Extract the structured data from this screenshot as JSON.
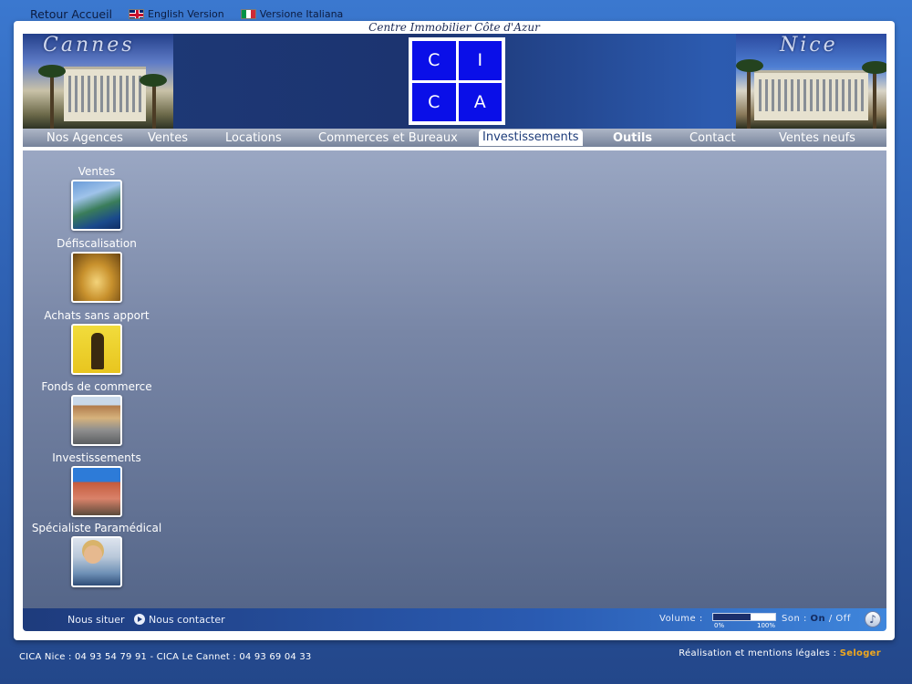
{
  "topbar": {
    "home": "Retour Accueil",
    "english": "English Version",
    "italian": "Versione Italiana"
  },
  "site_title": "Centre Immobilier Côte d'Azur",
  "banner": {
    "left_city": "Cannes",
    "right_city": "Nice",
    "logo_letters": [
      "C",
      "I",
      "C",
      "A"
    ]
  },
  "nav": {
    "items": [
      {
        "label": "Nos Agences"
      },
      {
        "label": "Ventes"
      },
      {
        "label": "Locations"
      },
      {
        "label": "Commerces et Bureaux"
      },
      {
        "label": "Investissements",
        "active": true
      },
      {
        "label": "Outils",
        "bold": true
      },
      {
        "label": "Contact"
      },
      {
        "label": "Ventes neufs"
      }
    ]
  },
  "categories": [
    {
      "label": "Ventes",
      "icon": "coast-photo-icon"
    },
    {
      "label": "Défiscalisation",
      "icon": "gold-coins-photo-icon"
    },
    {
      "label": "Achats sans apport",
      "icon": "keys-photo-icon"
    },
    {
      "label": "Fonds de commerce",
      "icon": "shopfront-photo-icon"
    },
    {
      "label": "Investissements",
      "icon": "building-photo-icon"
    },
    {
      "label": "Spécialiste Paramédical",
      "icon": "nurse-photo-icon"
    }
  ],
  "footer_bar": {
    "locate": "Nous situer",
    "contact": "Nous contacter",
    "volume_label": "Volume :",
    "volume_min": "0%",
    "volume_max": "100%",
    "volume_level": 0.6,
    "sound_label": "Son :",
    "sound_on": "On",
    "sound_sep": "/",
    "sound_off": "Off"
  },
  "page_footer": {
    "contact": "CICA Nice : 04 93 54 79 91 - CICA Le Cannet : 04 93 69 04 33",
    "credits": "Réalisation et mentions légales :",
    "brand": "Seloger"
  },
  "colors": {
    "logo_blue": "#0a0fe8",
    "accent_orange": "#f0a81e"
  }
}
